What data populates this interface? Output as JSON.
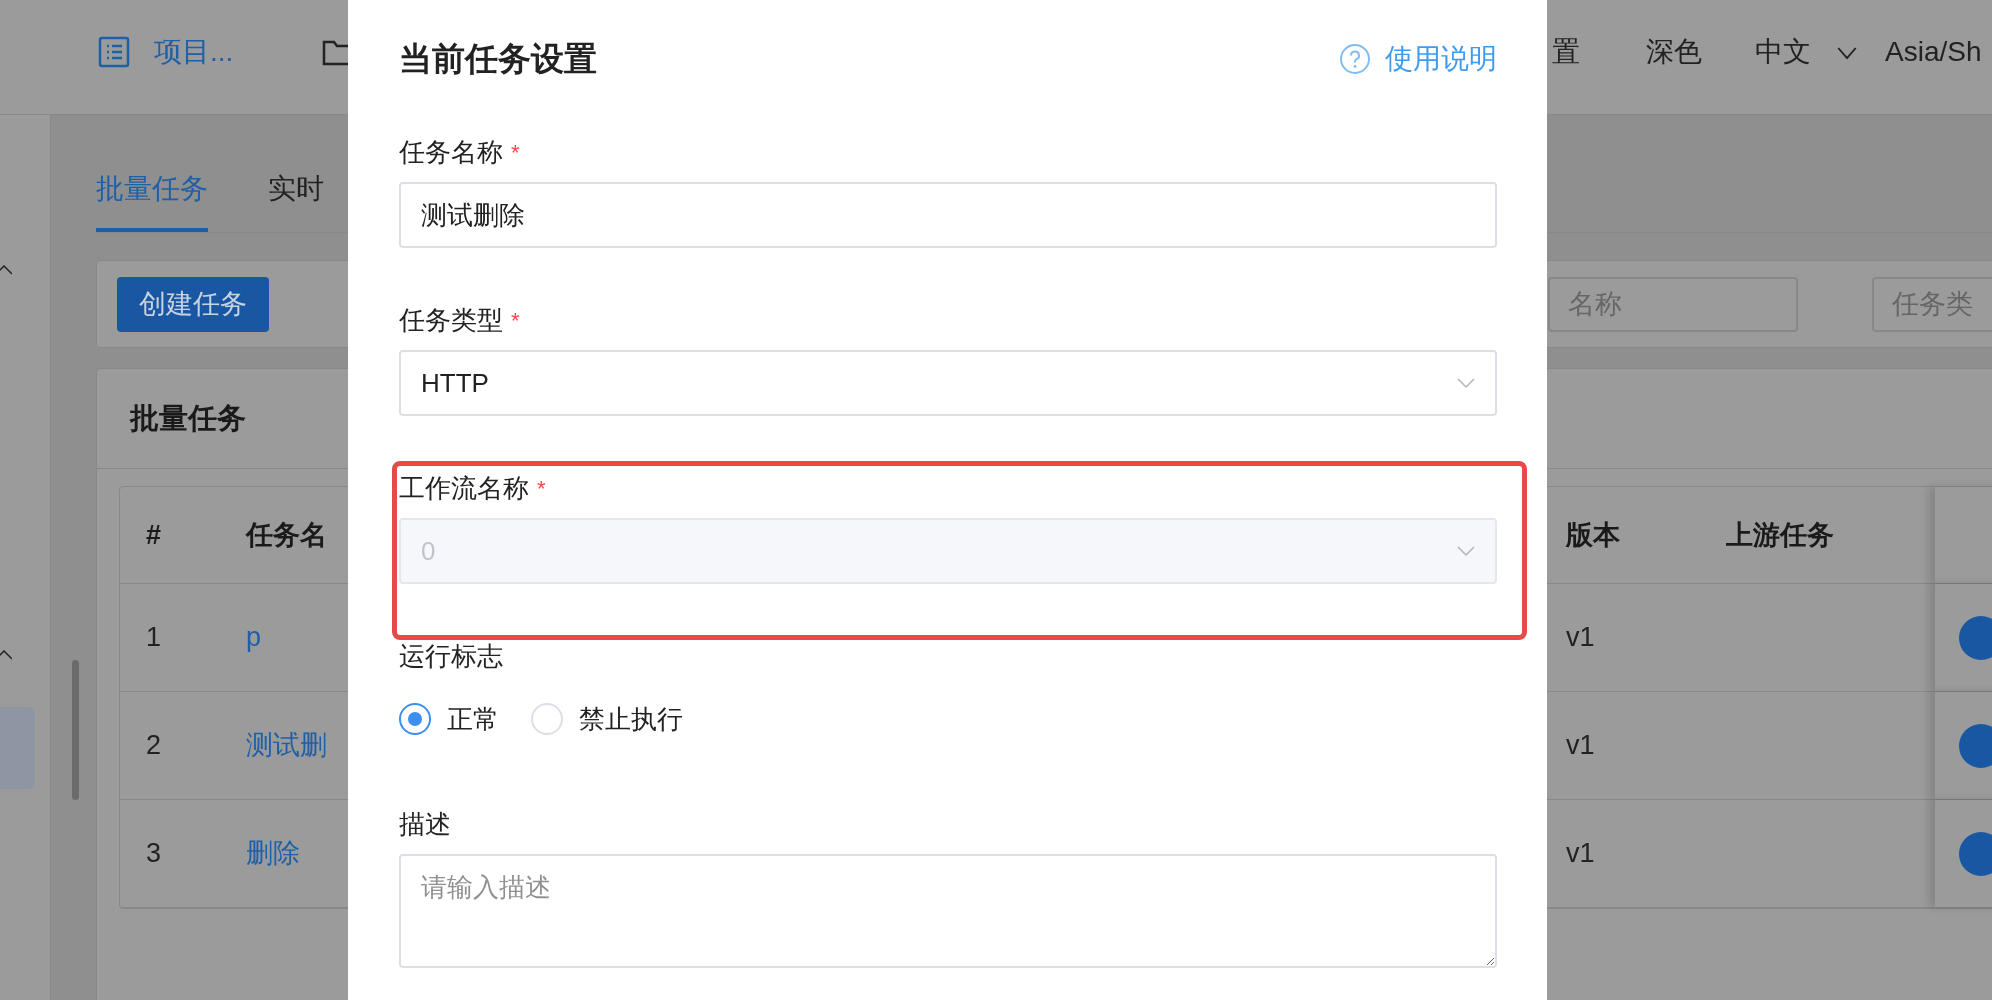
{
  "top_bar": {
    "project_link": "项目...",
    "settings_partial": "置",
    "theme": "深色",
    "language": "中文",
    "timezone": "Asia/Sh"
  },
  "tabs": [
    {
      "label": "批量任务",
      "selected": true
    },
    {
      "label": "实时",
      "selected": false
    }
  ],
  "toolbar": {
    "create_button": "创建任务",
    "filters": [
      {
        "placeholder": "名称"
      },
      {
        "placeholder": "任务类"
      }
    ]
  },
  "table_card": {
    "title": "批量任务",
    "columns": [
      "#",
      "任务名",
      "版本",
      "上游任务"
    ],
    "rows": [
      {
        "index": "1",
        "name": "p",
        "version": "v1"
      },
      {
        "index": "2",
        "name": "测试删",
        "version": "v1"
      },
      {
        "index": "3",
        "name": "删除",
        "version": "v1"
      }
    ]
  },
  "modal": {
    "title": "当前任务设置",
    "help_link": "使用说明",
    "fields": [
      {
        "kind": "text",
        "label": "任务名称",
        "required_mark": "*",
        "value": "测试删除"
      },
      {
        "kind": "select",
        "label": "任务类型",
        "required_mark": "*",
        "disabled": false,
        "value": "HTTP"
      },
      {
        "kind": "select",
        "label": "工作流名称",
        "required_mark": "*",
        "disabled": true,
        "highlighted": true,
        "value": "0"
      },
      {
        "kind": "radio",
        "label": "运行标志",
        "options": [
          {
            "label": "正常",
            "selected": true
          },
          {
            "label": "禁止执行",
            "selected": false
          }
        ]
      },
      {
        "kind": "textarea",
        "label": "描述",
        "placeholder": "请输入描述"
      }
    ]
  }
}
